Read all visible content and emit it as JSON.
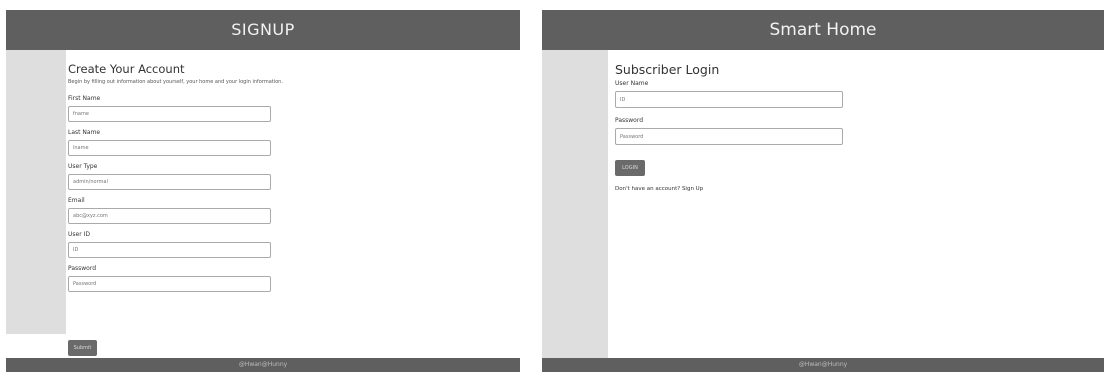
{
  "signup_page": {
    "header_title": "SIGNUP",
    "form_title": "Create Your Account",
    "intro": "Begin by filling out information about yourself, your home and your login information.",
    "fields": [
      {
        "label": "First Name",
        "placeholder": "fname"
      },
      {
        "label": "Last Name",
        "placeholder": "lname"
      },
      {
        "label": "User Type",
        "placeholder": "admin/normal"
      },
      {
        "label": "Email",
        "placeholder": "abc@xyz.com"
      },
      {
        "label": "User ID",
        "placeholder": "ID"
      },
      {
        "label": "Password",
        "placeholder": "Password"
      }
    ],
    "submit_label": "Submit",
    "footer_text": "@Hwan@Hunny"
  },
  "login_page": {
    "header_title": "Smart Home",
    "form_title": "Subscriber Login",
    "fields": [
      {
        "label": "User Name",
        "placeholder": "ID"
      },
      {
        "label": "Password",
        "placeholder": "Password"
      }
    ],
    "login_label": "LOGIN",
    "no_account_text": "Don't have an account?",
    "signup_link": "Sign Up",
    "footer_text": "@Hwan@Hunny"
  },
  "colors": {
    "header_bg": "#5f5f5f",
    "sidebar_bg": "#dedede",
    "button_bg": "#6a6a6a"
  }
}
